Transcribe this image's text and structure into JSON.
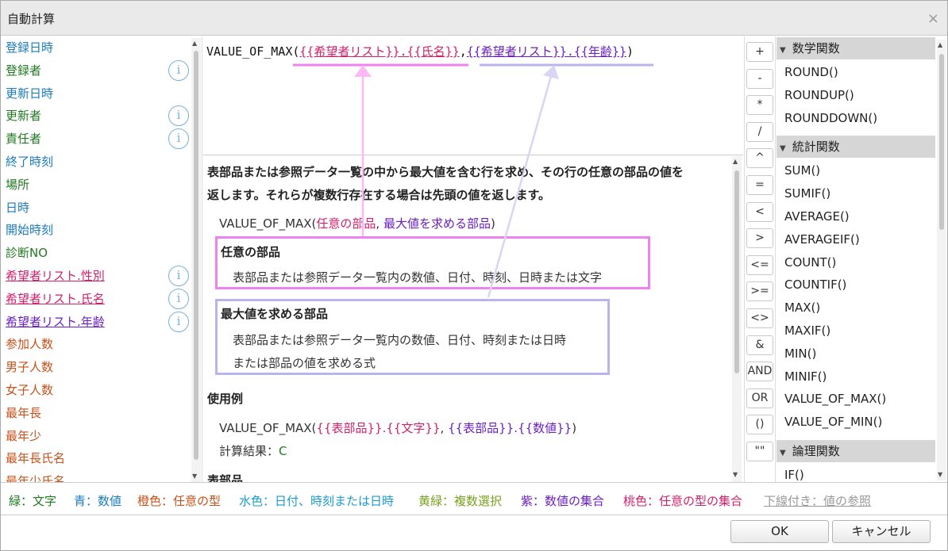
{
  "window": {
    "title": "自動計算",
    "close_glyph": "×"
  },
  "fields": [
    {
      "label": "登録日時",
      "color": "blue",
      "info": false
    },
    {
      "label": "登録者",
      "color": "green",
      "info": true
    },
    {
      "label": "更新日時",
      "color": "blue",
      "info": false
    },
    {
      "label": "更新者",
      "color": "green",
      "info": true
    },
    {
      "label": "責任者",
      "color": "green",
      "info": true
    },
    {
      "label": "終了時刻",
      "color": "blue",
      "info": false
    },
    {
      "label": "場所",
      "color": "green",
      "info": false
    },
    {
      "label": "日時",
      "color": "blue",
      "info": false
    },
    {
      "label": "開始時刻",
      "color": "blue",
      "info": false
    },
    {
      "label": "診断NO",
      "color": "green",
      "info": false
    },
    {
      "label": "希望者リスト.性別",
      "color": "pink",
      "info": true
    },
    {
      "label": "希望者リスト.氏名",
      "color": "pink",
      "info": true
    },
    {
      "label": "希望者リスト.年齢",
      "color": "purple",
      "info": true
    },
    {
      "label": "参加人数",
      "color": "orange",
      "info": false
    },
    {
      "label": "男子人数",
      "color": "orange",
      "info": false
    },
    {
      "label": "女子人数",
      "color": "orange",
      "info": false
    },
    {
      "label": "最年長",
      "color": "orange",
      "info": false
    },
    {
      "label": "最年少",
      "color": "orange",
      "info": false
    },
    {
      "label": "最年長氏名",
      "color": "orange",
      "info": false
    },
    {
      "label": "最年少氏名",
      "color": "orange",
      "info": false
    }
  ],
  "info_glyph": "i",
  "formula": {
    "fn_open": "VALUE_OF_MAX(",
    "arg1": "{{希望者リスト}}.{{氏名}}",
    "sep": ",",
    "arg2": "{{希望者リスト}}.{{年齢}}",
    "close": ")"
  },
  "help": {
    "desc_line1": "表部品または参照データ一覧の中から最大値を含む行を求め、その行の任意の部品の値を",
    "desc_line2": "返します。それらが複数行存在する場合は先頭の値を返します。",
    "sig_fn": "VALUE_OF_MAX(",
    "sig_arg1": "任意の部品",
    "sig_sep": ", ",
    "sig_arg2": "最大値を求める部品",
    "sig_close": ")",
    "param1_title": "任意の部品",
    "param1_desc": "表部品または参照データ一覧内の数値、日付、時刻、日時または文字",
    "param2_title": "最大値を求める部品",
    "param2_desc1": "表部品または参照データ一覧内の数値、日付、時刻または日時",
    "param2_desc2": "または部品の値を求める式",
    "example_title": "使用例",
    "ex_fn": "VALUE_OF_MAX(",
    "ex_arg1": "{{表部品}}.{{文字}}",
    "ex_sep": ", ",
    "ex_arg2": "{{表部品}}.{{数値}}",
    "ex_close": ")",
    "result_label": "計算結果：",
    "result_value": "C",
    "table_title": "表部品"
  },
  "operators": [
    "+",
    "-",
    "*",
    "/",
    "^",
    "=",
    "<",
    ">",
    "<=",
    ">=",
    "<>",
    "&",
    "AND",
    "OR",
    "()",
    "\"\""
  ],
  "function_groups": [
    {
      "name": "数学関数",
      "items": [
        "ROUND()",
        "ROUNDUP()",
        "ROUNDDOWN()"
      ]
    },
    {
      "name": "統計関数",
      "items": [
        "SUM()",
        "SUMIF()",
        "AVERAGE()",
        "AVERAGEIF()",
        "COUNT()",
        "COUNTIF()",
        "MAX()",
        "MAXIF()",
        "MIN()",
        "MINIF()",
        "VALUE_OF_MAX()",
        "VALUE_OF_MIN()"
      ]
    },
    {
      "name": "論理関数",
      "items": [
        "IF()"
      ]
    }
  ],
  "legend": {
    "green": "緑：文字",
    "blue": "青：数値",
    "orange": "橙色：任意の型",
    "lightblue": "水色：日付、時刻または日時",
    "yellowgreen": "黄緑：複数選択",
    "purple": "紫：数値の集合",
    "pink": "桃色：任意の型の集合",
    "underline": "下線付き：値の参照"
  },
  "buttons": {
    "ok": "OK",
    "cancel": "キャンセル"
  },
  "colors": {
    "green": "#207a20",
    "blue": "#1a7bbd",
    "orange": "#c8501a",
    "lightblue": "#1a9ccc",
    "yellowgreen": "#7aa020",
    "purple": "#6a1ec0",
    "pink": "#d1206c",
    "underline": "#999999",
    "highlight_pink": "#ee82ee",
    "highlight_lavender": "#b9b4ee"
  }
}
